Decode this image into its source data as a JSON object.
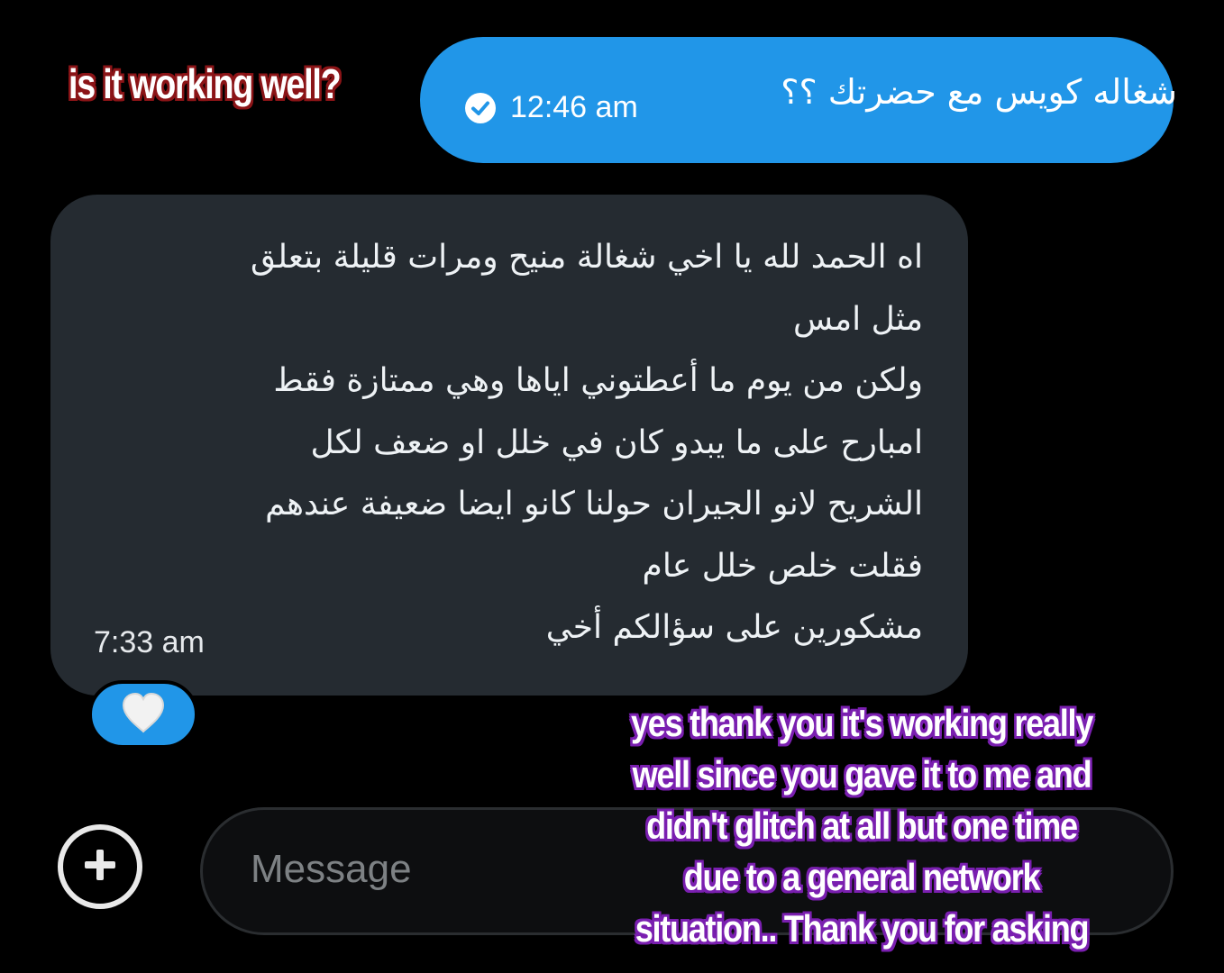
{
  "composer": {
    "placeholder": "Message",
    "add_icon": "plus-circle-icon"
  },
  "messages": {
    "sent": {
      "text": "شغاله كويس مع حضرتك ؟؟",
      "time": "12:46 am",
      "status_icon": "check-circle-icon"
    },
    "received": {
      "lines": [
        "اه الحمد لله يا اخي شغالة منيح ومرات قليلة بتعلق",
        "مثل امس",
        "ولكن من يوم ما أعطتوني اياها وهي ممتازة فقط",
        "امبارح على ما يبدو كان في خلل او ضعف لكل",
        "الشريح لانو الجيران حولنا كانو ايضا ضعيفة عندهم",
        "فقلت خلص خلل عام",
        "مشكورين على سؤالكم أخي"
      ],
      "time": "7:33 am",
      "reaction": "white-heart-icon"
    }
  },
  "captions": {
    "top": "is it working well?",
    "bottom": [
      "yes thank you it's working really",
      "well since you gave it to me and",
      "didn't glitch at all but one time",
      "due to a general network",
      "situation.. Thank you for asking"
    ]
  },
  "colors": {
    "background": "#000000",
    "sent_bubble": "#2196e8",
    "received_bubble": "#252b31",
    "top_caption_outline": "#8b1417",
    "bottom_caption_outline": "#7a1fb0"
  }
}
